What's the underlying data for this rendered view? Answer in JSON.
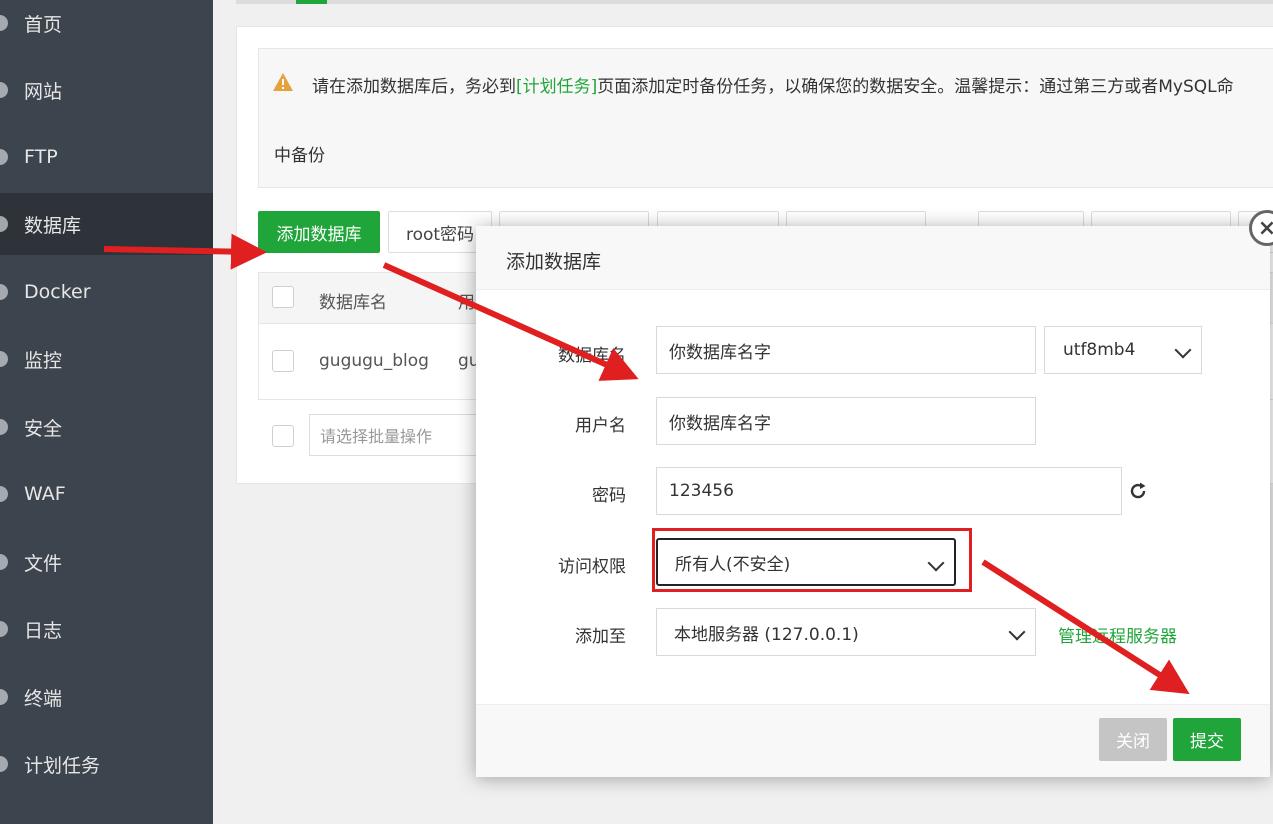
{
  "sidebar": {
    "items": [
      {
        "label": "首页"
      },
      {
        "label": "网站"
      },
      {
        "label": "FTP"
      },
      {
        "label": "数据库"
      },
      {
        "label": "Docker"
      },
      {
        "label": "监控"
      },
      {
        "label": "安全"
      },
      {
        "label": "WAF"
      },
      {
        "label": "文件"
      },
      {
        "label": "日志"
      },
      {
        "label": "终端"
      },
      {
        "label": "计划任务"
      }
    ],
    "active_index": 3
  },
  "alert": {
    "text_before": "请在添加数据库后，务必到",
    "link": "[计划任务]",
    "text_after": "页面添加定时备份任务，以确保您的数据安全。温馨提示：通过第三方或者MySQL命",
    "line2": "中备份"
  },
  "toolbar": {
    "add_db": "添加数据库",
    "root_pwd": "root密码"
  },
  "table": {
    "columns": [
      "数据库名",
      "用"
    ],
    "rows": [
      {
        "name": "gugugu_blog",
        "user": "gu"
      }
    ],
    "batch_placeholder": "请选择批量操作"
  },
  "modal": {
    "title": "添加数据库",
    "close_icon": "×",
    "fields": {
      "db_name_label": "数据库名",
      "db_name_value": "你数据库名字",
      "charset": "utf8mb4",
      "user_label": "用户名",
      "user_value": "你数据库名字",
      "password_label": "密码",
      "password_value": "123456",
      "access_label": "访问权限",
      "access_value": "所有人(不安全)",
      "addto_label": "添加至",
      "addto_value": "本地服务器 (127.0.0.1)",
      "manage_remote": "管理远程服务器"
    },
    "buttons": {
      "close": "关闭",
      "submit": "提交"
    }
  },
  "colors": {
    "accent_green": "#20a53a",
    "sidebar_bg": "#3c444d",
    "annotation_red": "#e02020"
  }
}
